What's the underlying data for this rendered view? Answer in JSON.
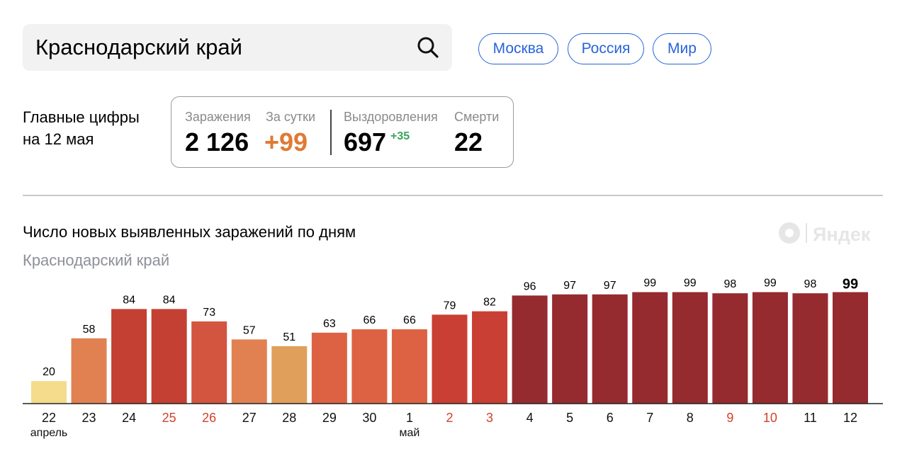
{
  "search": {
    "value": "Краснодарский край"
  },
  "chips": [
    {
      "label": "Москва"
    },
    {
      "label": "Россия"
    },
    {
      "label": "Мир"
    }
  ],
  "headline": {
    "line1": "Главные цифры",
    "line2": "на 12 мая"
  },
  "stats": {
    "infections": {
      "label": "Заражения",
      "value": "2 126"
    },
    "daily": {
      "label": "За сутки",
      "value": "+99"
    },
    "recovered": {
      "label": "Выздоровления",
      "value": "697",
      "delta": "+35"
    },
    "deaths": {
      "label": "Смерти",
      "value": "22"
    }
  },
  "brand": {
    "name": "Яндекс"
  },
  "colors": {
    "accent": "#2764d9",
    "daily_orange": "#e07a33",
    "delta_green": "#3aa35c",
    "weekend_red": "#d0422b",
    "scale": [
      "#f4dc8c",
      "#e0a05c",
      "#e18152",
      "#dd6243",
      "#c93f33",
      "#b53534",
      "#952a2f"
    ]
  },
  "chart_data": {
    "type": "bar",
    "title": "Число новых выявленных заражений по дням",
    "subtitle": "Краснодарский край",
    "categories": [
      "22",
      "23",
      "24",
      "25",
      "26",
      "27",
      "28",
      "29",
      "30",
      "1",
      "2",
      "3",
      "4",
      "5",
      "6",
      "7",
      "8",
      "9",
      "10",
      "11",
      "12"
    ],
    "values": [
      20,
      58,
      84,
      84,
      73,
      57,
      51,
      63,
      66,
      66,
      79,
      82,
      96,
      97,
      97,
      99,
      99,
      98,
      99,
      98,
      99
    ],
    "weekend": [
      "25",
      "26",
      "2",
      "3",
      "9",
      "10"
    ],
    "month_labels": [
      {
        "category": "22",
        "label": "апрель"
      },
      {
        "category": "1",
        "label": "май"
      }
    ],
    "highlight": "12",
    "ylim": [
      0,
      100
    ],
    "grid": false
  }
}
